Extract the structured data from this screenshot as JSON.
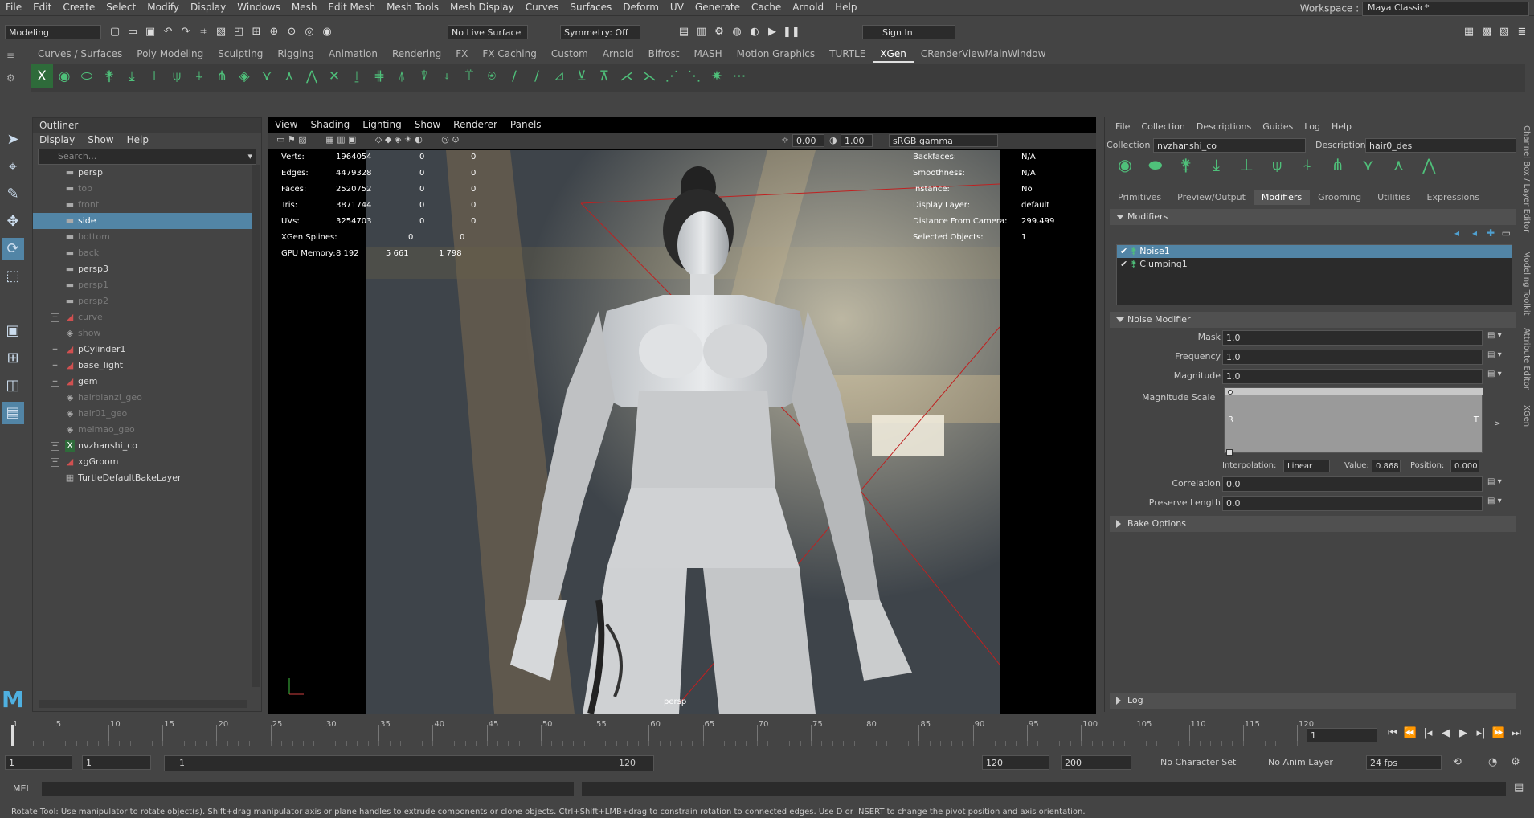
{
  "menubar": [
    "File",
    "Edit",
    "Create",
    "Select",
    "Modify",
    "Display",
    "Windows",
    "Mesh",
    "Edit Mesh",
    "Mesh Tools",
    "Mesh Display",
    "Curves",
    "Surfaces",
    "Deform",
    "UV",
    "Generate",
    "Cache",
    "Arnold",
    "Help"
  ],
  "workspace": {
    "label": "Workspace :",
    "value": "Maya Classic*"
  },
  "statusline": {
    "mode": "Modeling",
    "live_surface": "No Live Surface",
    "symmetry": "Symmetry: Off",
    "sign_in": "Sign In"
  },
  "shelf_tabs": [
    "Curves / Surfaces",
    "Poly Modeling",
    "Sculpting",
    "Rigging",
    "Animation",
    "Rendering",
    "FX",
    "FX Caching",
    "Custom",
    "Arnold",
    "Bifrost",
    "MASH",
    "Motion Graphics",
    "TURTLE",
    "XGen",
    "CRenderViewMainWindow"
  ],
  "shelf_active": "XGen",
  "outliner": {
    "title": "Outliner",
    "menu": [
      "Display",
      "Show",
      "Help"
    ],
    "search_placeholder": "Search...",
    "items": [
      {
        "label": "persp",
        "icon": "camera-icon",
        "dim": false,
        "expand": false,
        "selected": false
      },
      {
        "label": "top",
        "icon": "camera-icon",
        "dim": true,
        "expand": false,
        "selected": false
      },
      {
        "label": "front",
        "icon": "camera-icon",
        "dim": true,
        "expand": false,
        "selected": false
      },
      {
        "label": "side",
        "icon": "camera-icon",
        "dim": false,
        "expand": false,
        "selected": true
      },
      {
        "label": "bottom",
        "icon": "camera-icon",
        "dim": true,
        "expand": false,
        "selected": false
      },
      {
        "label": "back",
        "icon": "camera-icon",
        "dim": true,
        "expand": false,
        "selected": false
      },
      {
        "label": "persp3",
        "icon": "camera-icon",
        "dim": false,
        "expand": false,
        "selected": false
      },
      {
        "label": "persp1",
        "icon": "camera-icon",
        "dim": true,
        "expand": false,
        "selected": false
      },
      {
        "label": "persp2",
        "icon": "camera-icon",
        "dim": true,
        "expand": false,
        "selected": false
      },
      {
        "label": "curve",
        "icon": "mesh-icon",
        "dim": true,
        "expand": true,
        "selected": false
      },
      {
        "label": "show",
        "icon": "set-icon",
        "dim": true,
        "expand": false,
        "selected": false
      },
      {
        "label": "pCylinder1",
        "icon": "mesh-icon",
        "dim": false,
        "expand": true,
        "selected": false
      },
      {
        "label": "base_light",
        "icon": "mesh-icon",
        "dim": false,
        "expand": true,
        "selected": false
      },
      {
        "label": "gem",
        "icon": "mesh-icon",
        "dim": false,
        "expand": true,
        "selected": false
      },
      {
        "label": "hairbianzi_geo",
        "icon": "set-icon",
        "dim": true,
        "expand": false,
        "selected": false
      },
      {
        "label": "hair01_geo",
        "icon": "set-icon",
        "dim": true,
        "expand": false,
        "selected": false
      },
      {
        "label": "meimao_geo",
        "icon": "set-icon",
        "dim": true,
        "expand": false,
        "selected": false
      },
      {
        "label": "nvzhanshi_co",
        "icon": "xgen-icon",
        "dim": false,
        "expand": true,
        "selected": false
      },
      {
        "label": "xgGroom",
        "icon": "mesh-icon",
        "dim": false,
        "expand": true,
        "selected": false
      },
      {
        "label": "TurtleDefaultBakeLayer",
        "icon": "layer-icon",
        "dim": false,
        "expand": false,
        "selected": false
      }
    ]
  },
  "viewport": {
    "menu": [
      "View",
      "Shading",
      "Lighting",
      "Show",
      "Renderer",
      "Panels"
    ],
    "exposure": "0.00",
    "gamma": "1.00",
    "colorspace": "sRGB gamma",
    "camera_label": "persp",
    "hud_left": [
      {
        "k": "Verts:",
        "a": "1964054",
        "b": "0",
        "c": "0"
      },
      {
        "k": "Edges:",
        "a": "4479328",
        "b": "0",
        "c": "0"
      },
      {
        "k": "Faces:",
        "a": "2520752",
        "b": "0",
        "c": "0"
      },
      {
        "k": "Tris:",
        "a": "3871744",
        "b": "0",
        "c": "0"
      },
      {
        "k": "UVs:",
        "a": "3254703",
        "b": "0",
        "c": "0"
      },
      {
        "k": "XGen Splines:",
        "a": "",
        "b": "0",
        "c": "0"
      },
      {
        "k": "GPU Memory:",
        "a": "8 192",
        "b": "5 661",
        "c": "1 798"
      }
    ],
    "hud_right": [
      {
        "k": "Backfaces:",
        "v": "N/A"
      },
      {
        "k": "Smoothness:",
        "v": "N/A"
      },
      {
        "k": "Instance:",
        "v": "No"
      },
      {
        "k": "Display Layer:",
        "v": "default"
      },
      {
        "k": "Distance From Camera:",
        "v": "299.499"
      },
      {
        "k": "Selected Objects:",
        "v": "1"
      }
    ]
  },
  "xgen": {
    "menu": [
      "File",
      "Collection",
      "Descriptions",
      "Guides",
      "Log",
      "Help"
    ],
    "collection_label": "Collection",
    "collection_value": "nvzhanshi_co",
    "description_label": "Description",
    "description_value": "hair0_des",
    "tabs": [
      "Primitives",
      "Preview/Output",
      "Modifiers",
      "Grooming",
      "Utilities",
      "Expressions"
    ],
    "active_tab": "Modifiers",
    "modifiers_header": "Modifiers",
    "modifiers": [
      {
        "label": "Noise1",
        "selected": true
      },
      {
        "label": "Clumping1",
        "selected": false
      }
    ],
    "noise_header": "Noise Modifier",
    "fields": [
      {
        "label": "Mask",
        "value": "1.0"
      },
      {
        "label": "Frequency",
        "value": "1.0"
      },
      {
        "label": "Magnitude",
        "value": "1.0"
      }
    ],
    "magnitude_scale": {
      "label": "Magnitude Scale",
      "left": "R",
      "right": "T",
      "interp_label": "Interpolation:",
      "interp": "Linear",
      "value_label": "Value:",
      "value": "0.868",
      "pos_label": "Position:",
      "pos": "0.000"
    },
    "fields2": [
      {
        "label": "Correlation",
        "value": "0.0"
      },
      {
        "label": "Preserve Length",
        "value": "0.0"
      }
    ],
    "bake_header": "Bake Options",
    "log_header": "Log"
  },
  "side_tabs": [
    "Channel Box / Layer Editor",
    "Modeling Toolkit",
    "Attribute Editor",
    "XGen"
  ],
  "timeline": {
    "ticks": [
      "1",
      "5",
      "10",
      "15",
      "20",
      "25",
      "30",
      "35",
      "40",
      "45",
      "50",
      "55",
      "60",
      "65",
      "70",
      "75",
      "80",
      "85",
      "90",
      "95",
      "100",
      "105",
      "110",
      "115",
      "120"
    ],
    "current_frame": "1"
  },
  "range": {
    "start": "1",
    "start2": "1",
    "slider_start": "1",
    "slider_end": "120",
    "end": "120",
    "end2": "200",
    "char_set": "No Character Set",
    "anim_layer": "No Anim Layer",
    "fps": "24 fps"
  },
  "mel": {
    "label": "MEL"
  },
  "helpline": "Rotate Tool: Use manipulator to rotate object(s). Shift+drag manipulator axis or plane handles to extrude components or clone objects. Ctrl+Shift+LMB+drag to constrain rotation to connected edges. Use D or INSERT to change the pivot position and axis orientation."
}
